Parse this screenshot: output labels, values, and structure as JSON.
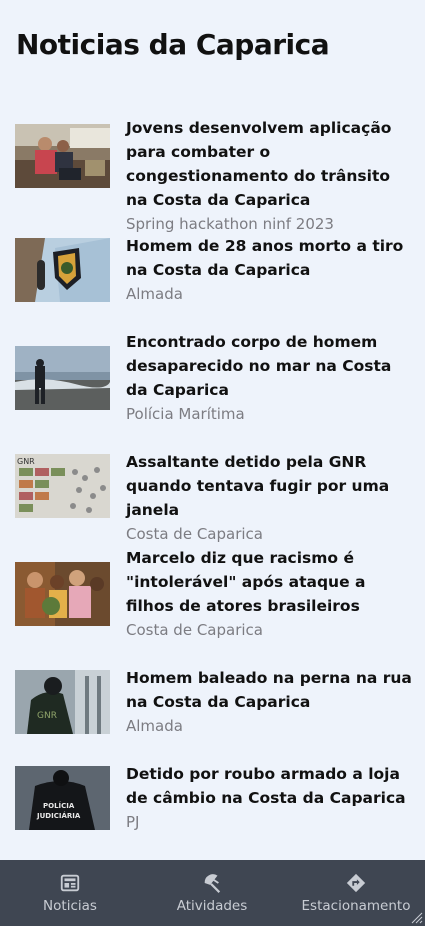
{
  "header": {
    "title": "Noticias da Caparica"
  },
  "news": [
    {
      "headline": "Jovens desenvolvem aplicação para combater o congestionamento do trânsito na Costa da Caparica",
      "source": "Spring hackathon ninf 2023",
      "image": "hackathon-photo"
    },
    {
      "headline": "Homem de 28 anos morto a tiro na Costa da Caparica",
      "source": "Almada",
      "image": "police-badge-photo"
    },
    {
      "headline": "Encontrado corpo de homem desaparecido no mar na Costa da Caparica",
      "source": "Polícia Marítima",
      "image": "beach-photo"
    },
    {
      "headline": "Assaltante detido pela GNR quando tentava fugir por uma janela",
      "source": "Costa de Caparica",
      "image": "seized-items-photo"
    },
    {
      "headline": "Marcelo diz que racismo é \"intolerável\" após ataque a filhos de atores brasileiros",
      "source": "Costa de Caparica",
      "image": "family-photo"
    },
    {
      "headline": "Homem baleado na perna na rua na Costa da Caparica",
      "source": "Almada",
      "image": "gnr-officer-photo"
    },
    {
      "headline": "Detido por roubo armado a loja de câmbio na Costa da Caparica",
      "source": "PJ",
      "image": "policia-judiciaria-photo"
    }
  ],
  "nav": {
    "items": [
      {
        "label": "Noticias",
        "icon": "newspaper-icon"
      },
      {
        "label": "Atividades",
        "icon": "beach-umbrella-icon"
      },
      {
        "label": "Estacionamento",
        "icon": "directions-icon"
      }
    ]
  },
  "colors": {
    "background": "#eef3fb",
    "nav_bg": "#3f4652",
    "nav_text": "#c8ccd3",
    "source_text": "#7c7c82"
  }
}
